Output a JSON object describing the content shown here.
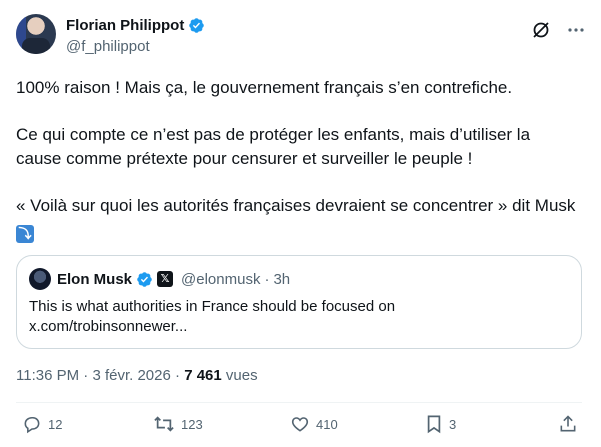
{
  "author": {
    "display_name": "Florian Philippot",
    "handle": "@f_philippot"
  },
  "tweet": {
    "paragraphs": [
      "100% raison ! Mais ça, le gouvernement français s’en contrefiche.",
      "Ce qui compte ce n’est pas de protéger les enfants, mais d’utiliser la cause comme prétexte pour censurer et surveiller le peuple !",
      "« Voilà sur quoi les autorités françaises devraient se concentrer » dit Musk"
    ],
    "emoji": "⤵"
  },
  "quoted": {
    "display_name": "Elon Musk",
    "badge": "𝕏",
    "handle": "@elonmusk",
    "separator": "·",
    "time": "3h",
    "text": "This is what authorities in France should be focused on",
    "link": "x.com/trobinsonnewer..."
  },
  "meta": {
    "time": "11:36 PM",
    "sep": "·",
    "date": "3 févr. 2026",
    "views_count": "7 461",
    "views_label": "vues"
  },
  "actions": {
    "replies": "12",
    "reposts": "123",
    "likes": "410",
    "bookmarks": "3"
  },
  "colors": {
    "verified": "#1d9bf0",
    "text": "#0f1419",
    "muted": "#536471",
    "border": "#cfd9de"
  },
  "icons": [
    "verified-icon",
    "grok-icon",
    "more-icon",
    "reply-icon",
    "repost-icon",
    "like-icon",
    "bookmark-icon",
    "share-icon"
  ]
}
